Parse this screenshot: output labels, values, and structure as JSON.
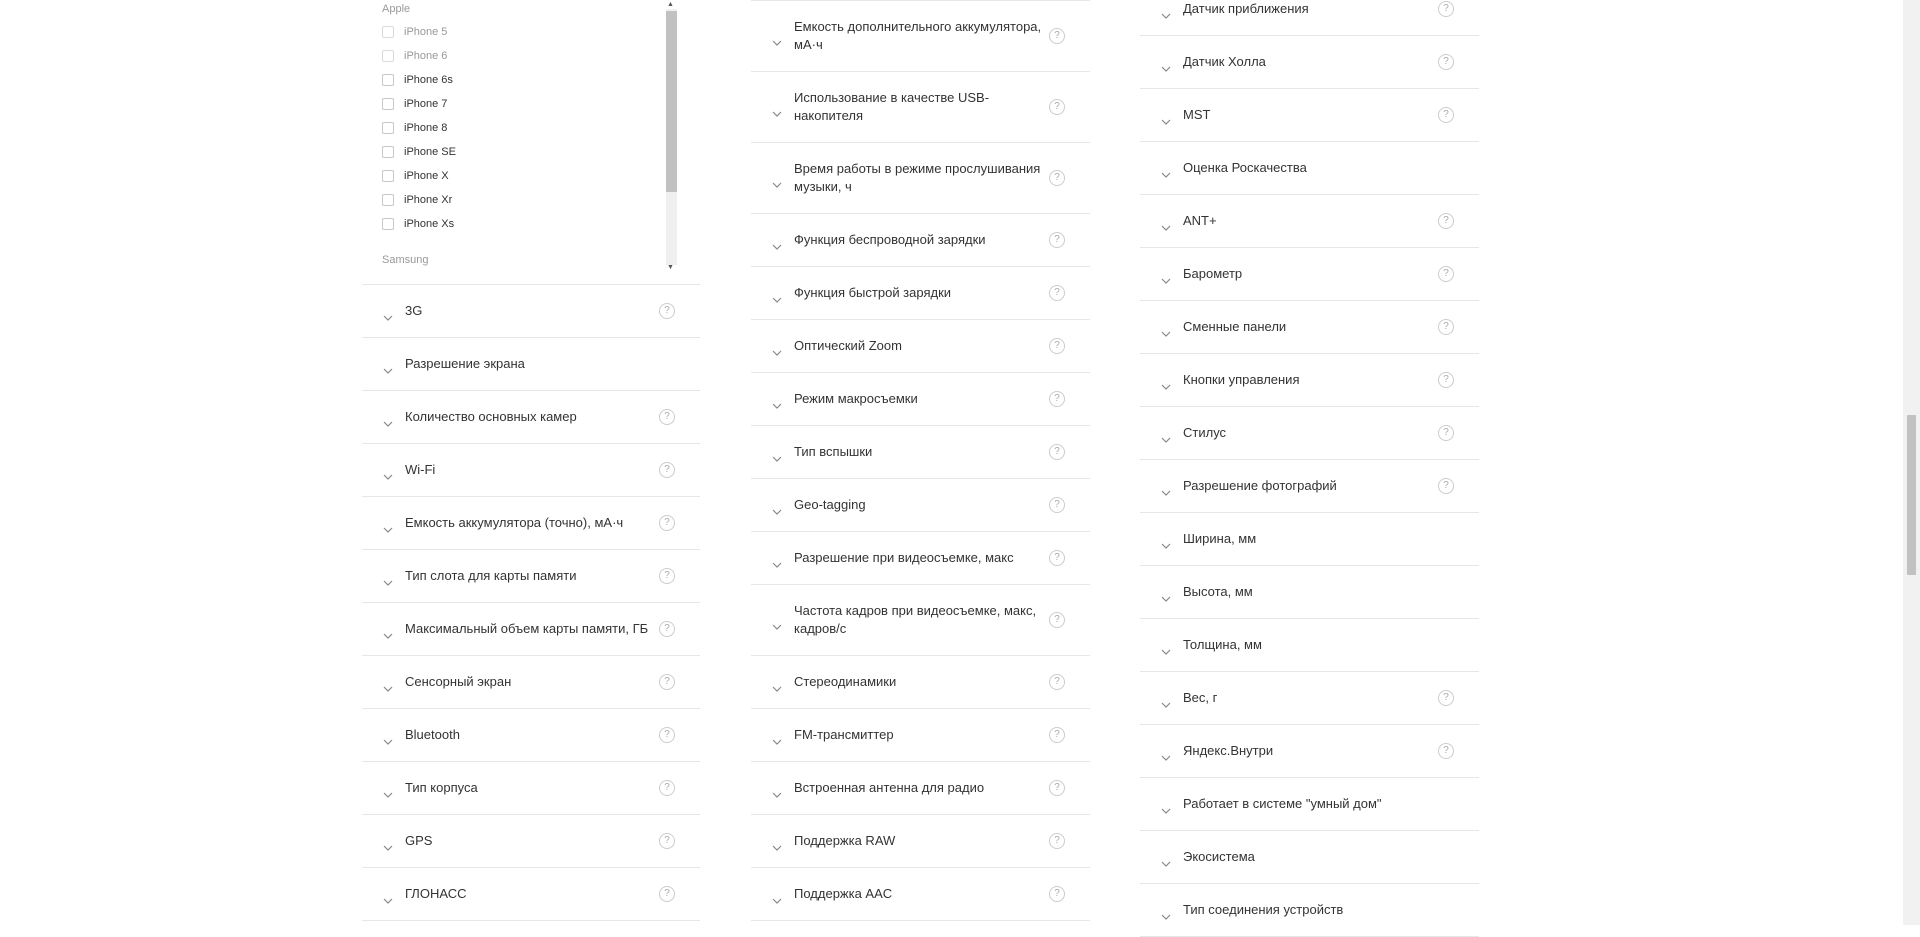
{
  "brand_filter": {
    "groups": [
      {
        "name": "Apple",
        "items": [
          {
            "label": "iPhone 5",
            "enabled": false
          },
          {
            "label": "iPhone 6",
            "enabled": false
          },
          {
            "label": "iPhone 6s",
            "enabled": true
          },
          {
            "label": "iPhone 7",
            "enabled": true
          },
          {
            "label": "iPhone 8",
            "enabled": true
          },
          {
            "label": "iPhone SE",
            "enabled": true
          },
          {
            "label": "iPhone X",
            "enabled": true
          },
          {
            "label": "iPhone Xr",
            "enabled": true
          },
          {
            "label": "iPhone Xs",
            "enabled": true
          }
        ]
      },
      {
        "name": "Samsung",
        "items": []
      }
    ],
    "scroll_up_icon": "triangle-up-icon",
    "scroll_down_icon": "triangle-down-icon"
  },
  "columns": [
    {
      "rows": [
        {
          "label": "3G",
          "help": true
        },
        {
          "label": "Разрешение экрана",
          "help": false
        },
        {
          "label": "Количество основных камер",
          "help": true
        },
        {
          "label": "Wi-Fi",
          "help": true
        },
        {
          "label": "Емкость аккумулятора (точно), мА·ч",
          "help": true
        },
        {
          "label": "Тип слота для карты памяти",
          "help": true
        },
        {
          "label": "Максимальный объем карты памяти, ГБ",
          "help": true
        },
        {
          "label": "Сенсорный экран",
          "help": true
        },
        {
          "label": "Bluetooth",
          "help": true
        },
        {
          "label": "Тип корпуса",
          "help": true
        },
        {
          "label": "GPS",
          "help": true
        },
        {
          "label": "ГЛОНАСС",
          "help": true
        }
      ]
    },
    {
      "rows": [
        {
          "label": "Емкость дополнительного аккумулятора, мА·ч",
          "help": true
        },
        {
          "label": "Использование в качестве USB-накопителя",
          "help": true
        },
        {
          "label": "Время работы в режиме прослушивания музыки, ч",
          "help": true
        },
        {
          "label": "Функция беспроводной зарядки",
          "help": true
        },
        {
          "label": "Функция быстрой зарядки",
          "help": true
        },
        {
          "label": "Оптический Zoom",
          "help": true
        },
        {
          "label": "Режим макросъемки",
          "help": true
        },
        {
          "label": "Тип вспышки",
          "help": true
        },
        {
          "label": "Geo-tagging",
          "help": true
        },
        {
          "label": "Разрешение при видеосъемке, макс",
          "help": true
        },
        {
          "label": "Частота кадров при видеосъемке, макс, кадров/с",
          "help": true
        },
        {
          "label": "Стереодинамики",
          "help": true
        },
        {
          "label": "FM-трансмиттер",
          "help": true
        },
        {
          "label": "Встроенная антенна для радио",
          "help": true
        },
        {
          "label": "Поддержка RAW",
          "help": true
        },
        {
          "label": "Поддержка AAC",
          "help": true
        }
      ]
    },
    {
      "rows": [
        {
          "label": "Датчик приближения",
          "help": true
        },
        {
          "label": "Датчик Холла",
          "help": true
        },
        {
          "label": "MST",
          "help": true
        },
        {
          "label": "Оценка Роскачества",
          "help": false
        },
        {
          "label": "ANT+",
          "help": true
        },
        {
          "label": "Барометр",
          "help": true
        },
        {
          "label": "Сменные панели",
          "help": true
        },
        {
          "label": "Кнопки управления",
          "help": true
        },
        {
          "label": "Стилус",
          "help": true
        },
        {
          "label": "Разрешение фотографий",
          "help": true
        },
        {
          "label": "Ширина, мм",
          "help": false
        },
        {
          "label": "Высота, мм",
          "help": false
        },
        {
          "label": "Толщина, мм",
          "help": false
        },
        {
          "label": "Вес, г",
          "help": true
        },
        {
          "label": "Яндекс.Внутри",
          "help": true
        },
        {
          "label": "Работает в системе \"умный дом\"",
          "help": false
        },
        {
          "label": "Экосистема",
          "help": false
        },
        {
          "label": "Тип соединения устройств",
          "help": false
        }
      ]
    }
  ],
  "help_glyph": "?",
  "icons": {
    "row_toggle": "chevron-down-icon",
    "help": "help-icon"
  },
  "colors": {
    "text": "#333333",
    "muted": "#999999",
    "divider": "#e6e6e6",
    "help_border": "#cccccc"
  }
}
